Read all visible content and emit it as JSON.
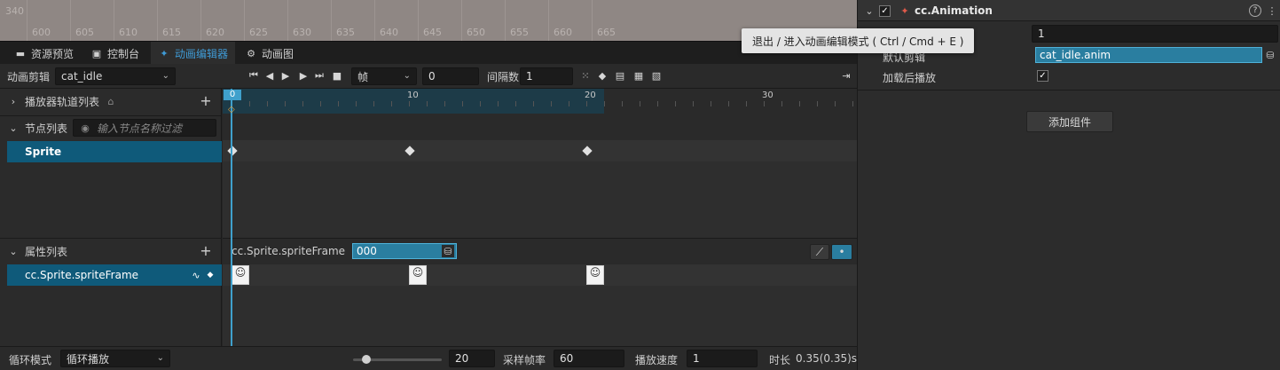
{
  "scene_ruler": {
    "top_label": "340",
    "labels": [
      "600",
      "605",
      "610",
      "615",
      "620",
      "625",
      "630",
      "635",
      "640",
      "645",
      "650",
      "655",
      "660",
      "665"
    ]
  },
  "tabs": [
    {
      "label": "资源预览",
      "icon": "folder-icon"
    },
    {
      "label": "控制台",
      "icon": "terminal-icon"
    },
    {
      "label": "动画编辑器",
      "icon": "run-icon"
    },
    {
      "label": "动画图",
      "icon": "graph-icon"
    }
  ],
  "toolbar": {
    "clip_label": "动画剪辑",
    "clip_value": "cat_idle",
    "unit_value": "帧",
    "frame_value": "0",
    "spacing_label": "间隔数",
    "spacing_value": "1"
  },
  "left": {
    "player_tracks_label": "播放器轨道列表",
    "node_list_label": "节点列表",
    "node_filter_placeholder": "输入节点名称过滤",
    "node_selected": "Sprite",
    "prop_list_label": "属性列表",
    "prop_selected": "cc.Sprite.spriteFrame"
  },
  "timeline": {
    "cursor_frame": "0",
    "frame_labels": [
      "10",
      "20",
      "30"
    ],
    "prop_name": "cc.Sprite.spriteFrame",
    "prop_value": "000"
  },
  "bottom": {
    "loop_label": "循环模式",
    "loop_value": "循环播放",
    "zoom_value": "20",
    "sample_label": "采样帧率",
    "sample_value": "60",
    "speed_label": "播放速度",
    "speed_value": "1",
    "duration_label": "时长",
    "duration_value": "0.35(0.35)s"
  },
  "inspector": {
    "component_title": "cc.Animation",
    "first_value": "1",
    "default_clip_label": "默认剪辑",
    "default_clip_value": "cat_idle.anim",
    "play_on_load_label": "加载后播放",
    "add_component_label": "添加组件"
  },
  "tooltip": "退出 / 进入动画编辑模式 ( Ctrl / Cmd + E )",
  "colors": {
    "accent": "#3f9bd6",
    "selection": "#0f5a7a",
    "cursor": "#3fa0cc"
  }
}
